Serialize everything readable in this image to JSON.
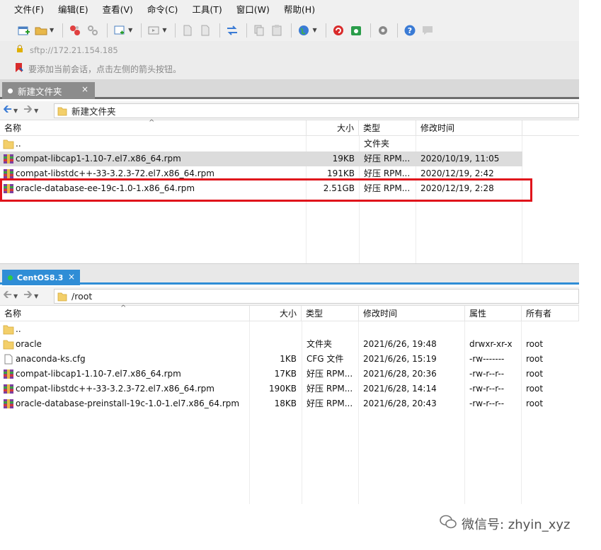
{
  "menu": [
    "文件(F)",
    "编辑(E)",
    "查看(V)",
    "命令(C)",
    "工具(T)",
    "窗口(W)",
    "帮助(H)"
  ],
  "address": {
    "url": "sftp://172.21.154.185"
  },
  "hint": {
    "text": "要添加当前会话，点击左侧的箭头按钮。"
  },
  "local_tab": {
    "label": "新建文件夹",
    "close": "×"
  },
  "local_path": "新建文件夹",
  "local_headers": {
    "name": "名称",
    "size": "大小",
    "type": "类型",
    "modified": "修改时间"
  },
  "local_files": [
    {
      "name": "..",
      "size": "",
      "type": "文件夹",
      "modified": "",
      "icon": "folder-icon",
      "selected": false
    },
    {
      "name": "compat-libcap1-1.10-7.el7.x86_64.rpm",
      "size": "19KB",
      "type": "好压 RPM...",
      "modified": "2020/10/19, 11:05",
      "icon": "rpm-archive-icon",
      "selected": true
    },
    {
      "name": "compat-libstdc++-33-3.2.3-72.el7.x86_64.rpm",
      "size": "191KB",
      "type": "好压 RPM...",
      "modified": "2020/12/19, 2:42",
      "icon": "rpm-archive-icon",
      "selected": false
    },
    {
      "name": "oracle-database-ee-19c-1.0-1.x86_64.rpm",
      "size": "2.51GB",
      "type": "好压 RPM...",
      "modified": "2020/12/19, 2:28",
      "icon": "rpm-archive-icon",
      "selected": false
    }
  ],
  "remote_tab": {
    "label": "CentOS8.3",
    "close": "×"
  },
  "remote_path": "/root",
  "remote_headers": {
    "name": "名称",
    "size": "大小",
    "type": "类型",
    "modified": "修改时间",
    "attr": "属性",
    "owner": "所有者"
  },
  "remote_files": [
    {
      "name": "..",
      "size": "",
      "type": "",
      "modified": "",
      "attr": "",
      "owner": "",
      "icon": "folder-icon"
    },
    {
      "name": "oracle",
      "size": "",
      "type": "文件夹",
      "modified": "2021/6/26, 19:48",
      "attr": "drwxr-xr-x",
      "owner": "root",
      "icon": "folder-icon"
    },
    {
      "name": "anaconda-ks.cfg",
      "size": "1KB",
      "type": "CFG 文件",
      "modified": "2021/6/26, 15:19",
      "attr": "-rw-------",
      "owner": "root",
      "icon": "document-icon"
    },
    {
      "name": "compat-libcap1-1.10-7.el7.x86_64.rpm",
      "size": "17KB",
      "type": "好压 RPM...",
      "modified": "2021/6/28, 20:36",
      "attr": "-rw-r--r--",
      "owner": "root",
      "icon": "rpm-archive-icon"
    },
    {
      "name": "compat-libstdc++-33-3.2.3-72.el7.x86_64.rpm",
      "size": "190KB",
      "type": "好压 RPM...",
      "modified": "2021/6/28, 14:14",
      "attr": "-rw-r--r--",
      "owner": "root",
      "icon": "rpm-archive-icon"
    },
    {
      "name": "oracle-database-preinstall-19c-1.0-1.el7.x86_64.rpm",
      "size": "18KB",
      "type": "好压 RPM...",
      "modified": "2021/6/28, 20:43",
      "attr": "-rw-r--r--",
      "owner": "root",
      "icon": "rpm-archive-icon"
    }
  ],
  "watermark": {
    "text": "微信号: zhyin_xyz"
  },
  "colors": {
    "accent": "#2f8dd6",
    "highlight": "#e0141b",
    "selected_row": "#dcdcdc"
  }
}
